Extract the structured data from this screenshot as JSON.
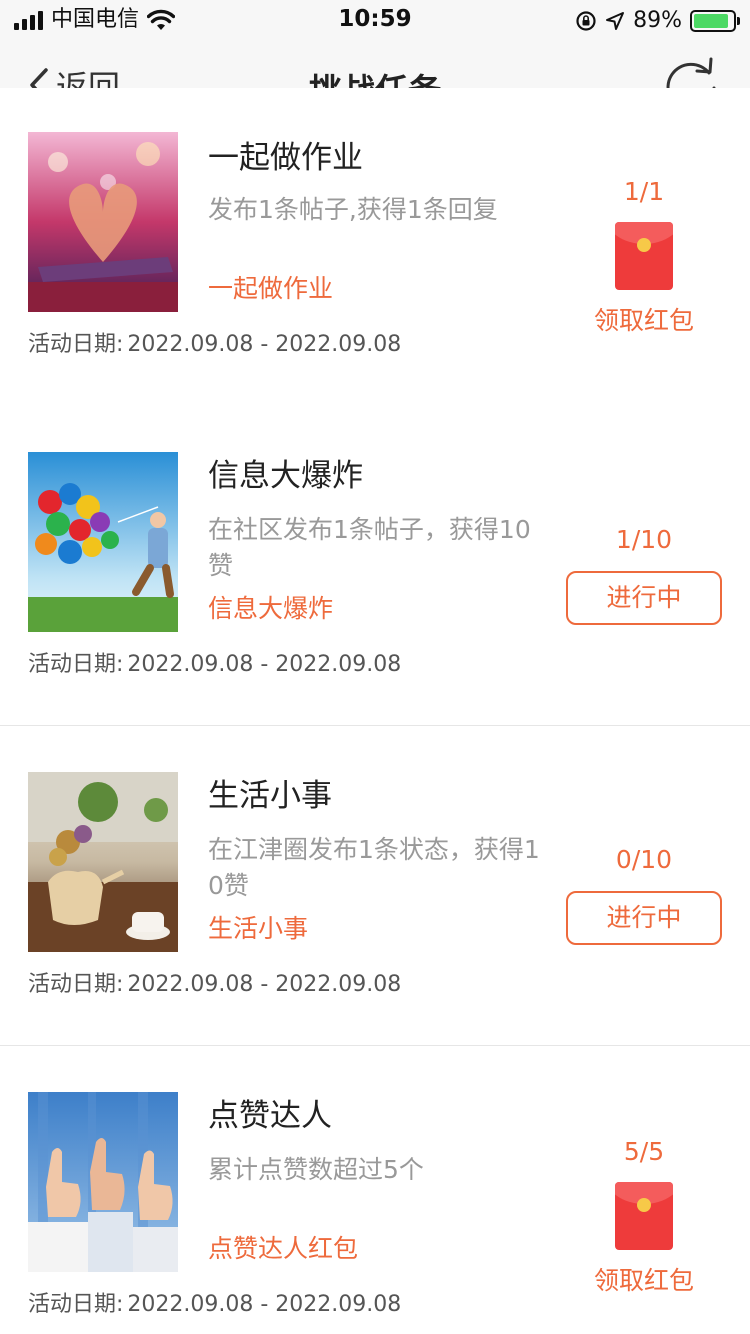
{
  "status_bar": {
    "carrier": "中国电信",
    "time": "10:59",
    "battery_percent": "89%",
    "battery_level": 0.89,
    "icons": [
      "signal-icon",
      "wifi-icon",
      "orientation-lock-icon",
      "location-icon",
      "battery-charging-icon"
    ]
  },
  "nav": {
    "back_label": "返回",
    "title": "挑战任务",
    "refresh_icon": "refresh-icon"
  },
  "colors": {
    "accent": "#ee6a3c",
    "red_packet": "#ee3b3b",
    "title_text": "#222222",
    "desc_text": "#999999"
  },
  "date_label": "活动日期:",
  "tasks": [
    {
      "title": "一起做作业",
      "desc": "发布1条帖子,获得1条回复",
      "tag": "一起做作业",
      "date": "2022.09.08 - 2022.09.08",
      "progress": "1/1",
      "action": "领取红包",
      "image": "book-heart-photo"
    },
    {
      "title": "信息大爆炸",
      "desc": "在社区发布1条帖子，获得10赞",
      "tag": "信息大爆炸",
      "date": "2022.09.08 - 2022.09.08",
      "progress": "1/10",
      "action": "进行中",
      "image": "balloons-child-photo"
    },
    {
      "title": "生活小事",
      "desc": "在江津圈发布1条状态，获得10赞",
      "tag": "生活小事",
      "date": "2022.09.08 - 2022.09.08",
      "progress": "0/10",
      "action": "进行中",
      "image": "flower-vase-teacup-photo"
    },
    {
      "title": "点赞达人",
      "desc": "累计点赞数超过5个",
      "tag": "点赞达人红包",
      "date": "2022.09.08 - 2022.09.08",
      "progress": "5/5",
      "action": "领取红包",
      "image": "thumbs-up-hands-photo"
    }
  ]
}
